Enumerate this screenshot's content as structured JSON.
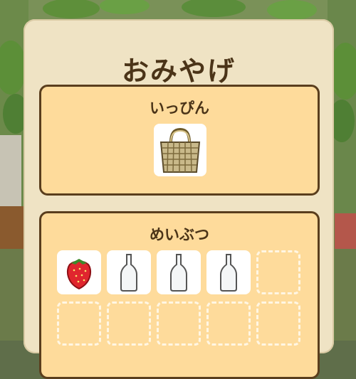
{
  "dialog": {
    "title": "おみやげ",
    "rare_section": {
      "label": "いっぴん",
      "item": "woven-basket-bag-icon"
    },
    "specialty_section": {
      "label": "めいぶつ",
      "slots": [
        {
          "item": "strawberry-icon"
        },
        {
          "item": "glass-bottle-icon"
        },
        {
          "item": "glass-bottle-icon"
        },
        {
          "item": "glass-bottle-icon"
        },
        {
          "item": null
        },
        {
          "item": null
        },
        {
          "item": null
        },
        {
          "item": null
        },
        {
          "item": null
        },
        {
          "item": null
        }
      ]
    }
  },
  "colors": {
    "panel": "#efe3c4",
    "section": "#fedb9b",
    "border": "#5a3e1d",
    "text": "#4b3418"
  }
}
